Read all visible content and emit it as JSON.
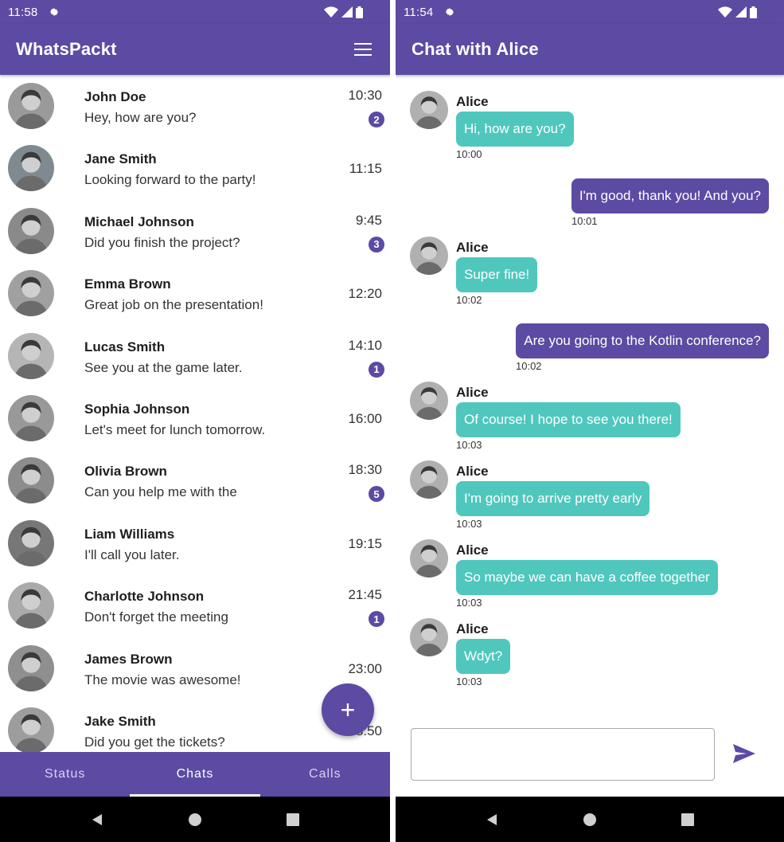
{
  "colors": {
    "primary": "#5c4aa3",
    "incoming_bubble": "#4fc7bd",
    "navbar": "#000000"
  },
  "left": {
    "status": {
      "time": "11:58"
    },
    "app_title": "WhatsPackt",
    "chats": [
      {
        "name": "John Doe",
        "message": "Hey, how are you?",
        "time": "10:30",
        "unread": "2"
      },
      {
        "name": "Jane Smith",
        "message": "Looking forward to the party!",
        "time": "11:15",
        "unread": ""
      },
      {
        "name": "Michael Johnson",
        "message": "Did you finish the project?",
        "time": "9:45",
        "unread": "3"
      },
      {
        "name": "Emma Brown",
        "message": "Great job on the presentation!",
        "time": "12:20",
        "unread": ""
      },
      {
        "name": "Lucas Smith",
        "message": "See you at the game later.",
        "time": "14:10",
        "unread": "1"
      },
      {
        "name": "Sophia Johnson",
        "message": "Let's meet for lunch tomorrow.",
        "time": "16:00",
        "unread": ""
      },
      {
        "name": "Olivia Brown",
        "message": "Can you help me with the",
        "time": "18:30",
        "unread": "5"
      },
      {
        "name": "Liam Williams",
        "message": "I'll call you later.",
        "time": "19:15",
        "unread": ""
      },
      {
        "name": "Charlotte Johnson",
        "message": "Don't forget the meeting",
        "time": "21:45",
        "unread": "1"
      },
      {
        "name": "James Brown",
        "message": "The movie was awesome!",
        "time": "23:00",
        "unread": ""
      },
      {
        "name": "Jake Smith",
        "message": "Did you get the tickets?",
        "time": "8:50",
        "unread": ""
      }
    ],
    "fab_label": "+",
    "tabs": [
      "Status",
      "Chats",
      "Calls"
    ],
    "active_tab": "Chats"
  },
  "right": {
    "status": {
      "time": "11:54"
    },
    "title": "Chat with Alice",
    "messages": [
      {
        "from": "Alice",
        "direction": "in",
        "text": "Hi, how are you?",
        "time": "10:00"
      },
      {
        "from": "me",
        "direction": "out",
        "text": "I'm good, thank you! And you?",
        "time": "10:01"
      },
      {
        "from": "Alice",
        "direction": "in",
        "text": "Super fine!",
        "time": "10:02"
      },
      {
        "from": "me",
        "direction": "out",
        "text": "Are you going to the Kotlin conference?",
        "time": "10:02"
      },
      {
        "from": "Alice",
        "direction": "in",
        "text": "Of course! I hope to see you there!",
        "time": "10:03"
      },
      {
        "from": "Alice",
        "direction": "in",
        "text": "I'm going to arrive pretty early",
        "time": "10:03"
      },
      {
        "from": "Alice",
        "direction": "in",
        "text": "So maybe we can have a coffee together",
        "time": "10:03"
      },
      {
        "from": "Alice",
        "direction": "in",
        "text": "Wdyt?",
        "time": "10:03"
      }
    ],
    "input": {
      "value": "",
      "placeholder": ""
    }
  }
}
